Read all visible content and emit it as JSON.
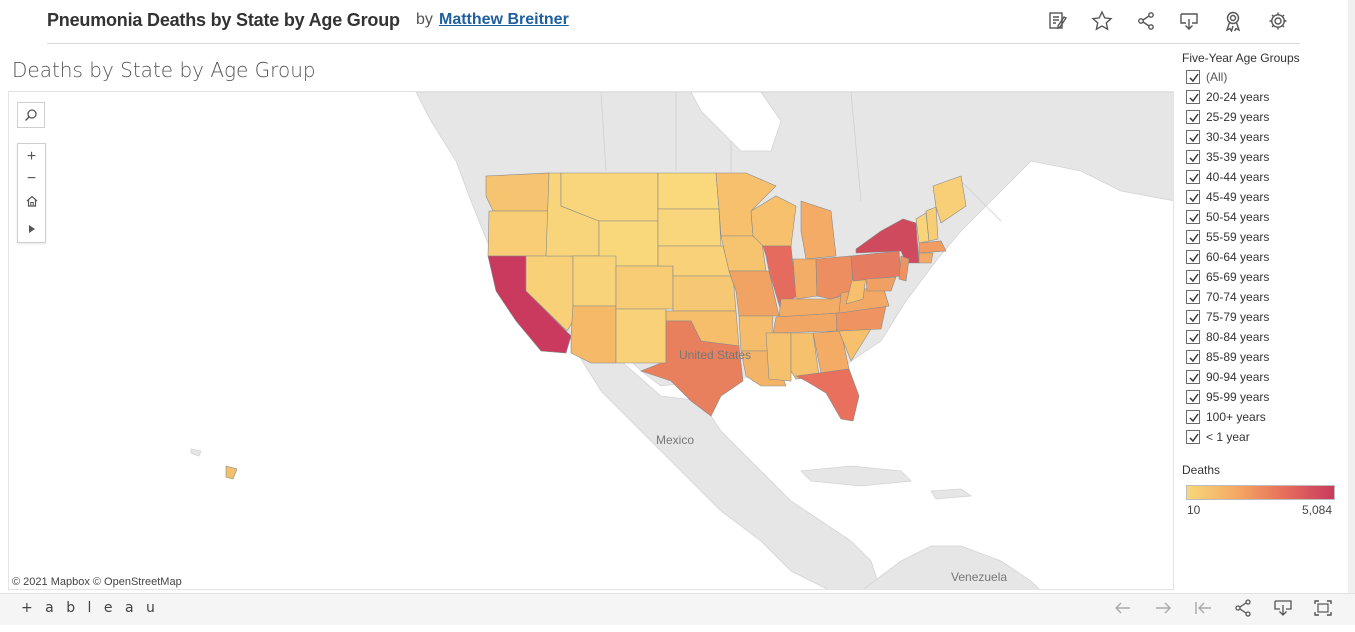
{
  "header": {
    "title": "Pneumonia Deaths by State by Age Group",
    "by": "by",
    "author": "Matthew Breitner",
    "icons": [
      "edit-icon",
      "star-icon",
      "share-icon",
      "download-icon",
      "badge-icon",
      "gear-icon"
    ]
  },
  "sheet": {
    "title": "Deaths by State by Age Group"
  },
  "map": {
    "labels": {
      "mexico": "Mexico",
      "venezuela": "Venezuela",
      "united_states": "United States"
    },
    "attribution": "© 2021 Mapbox  © OpenStreetMap"
  },
  "filter": {
    "title": "Five-Year Age Groups",
    "items": [
      {
        "label": "(All)",
        "checked": true
      },
      {
        "label": "20-24 years",
        "checked": true
      },
      {
        "label": "25-29 years",
        "checked": true
      },
      {
        "label": "30-34 years",
        "checked": true
      },
      {
        "label": "35-39 years",
        "checked": true
      },
      {
        "label": "40-44 years",
        "checked": true
      },
      {
        "label": "45-49 years",
        "checked": true
      },
      {
        "label": "50-54 years",
        "checked": true
      },
      {
        "label": "55-59 years",
        "checked": true
      },
      {
        "label": "60-64 years",
        "checked": true
      },
      {
        "label": "65-69 years",
        "checked": true
      },
      {
        "label": "70-74 years",
        "checked": true
      },
      {
        "label": "75-79 years",
        "checked": true
      },
      {
        "label": "80-84 years",
        "checked": true
      },
      {
        "label": "85-89 years",
        "checked": true
      },
      {
        "label": "90-94 years",
        "checked": true
      },
      {
        "label": "95-99 years",
        "checked": true
      },
      {
        "label": "100+ years",
        "checked": true
      },
      {
        "label": "< 1 year",
        "checked": true
      }
    ]
  },
  "legend": {
    "title": "Deaths",
    "min": "10",
    "max": "5,084",
    "colors": [
      "#f8d779",
      "#f3a763",
      "#e8705c",
      "#c93a5e"
    ]
  },
  "footer": {
    "logo": "+ a b l e a u",
    "icons": [
      "undo-icon",
      "redo-icon",
      "revert-icon",
      "share-icon",
      "download-icon",
      "fullscreen-icon"
    ]
  }
}
